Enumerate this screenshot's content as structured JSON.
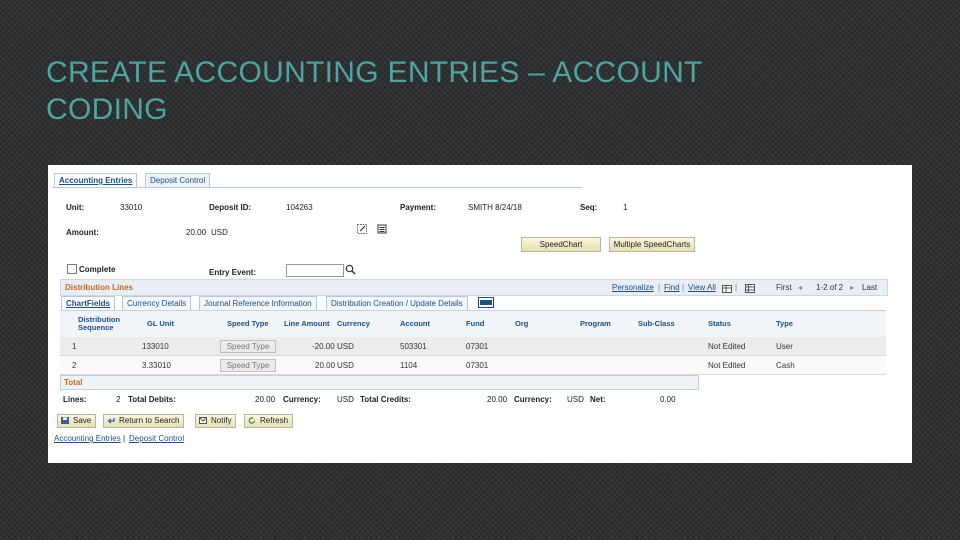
{
  "slide": {
    "title_line1": "CREATE ACCOUNTING ENTRIES – ACCOUNT",
    "title_line2": "CODING"
  },
  "tabs": [
    {
      "label": "Accounting Entries",
      "active": true
    },
    {
      "label": "Deposit Control",
      "active": false
    }
  ],
  "header": {
    "unit_label": "Unit:",
    "unit_value": "33010",
    "deposit_label": "Deposit ID:",
    "deposit_value": "104263",
    "payment_label": "Payment:",
    "payment_value": "SMITH 8/24/18",
    "seq_label": "Seq:",
    "seq_value": "1",
    "amount_label": "Amount:",
    "amount_value": "20.00",
    "amount_currency": "USD"
  },
  "buttons": {
    "speedchart": "SpeedChart",
    "multiple_speedcharts": "Multiple SpeedCharts"
  },
  "complete": {
    "label": "Complete",
    "checked": false
  },
  "entry_event": {
    "label": "Entry Event:",
    "value": ""
  },
  "distribution": {
    "title": "Distribution Lines",
    "nav": {
      "personalize": "Personalize",
      "find": "Find",
      "view_all": "View All",
      "first": "First",
      "count": "1-2 of 2",
      "last": "Last"
    },
    "subtabs": [
      "ChartFields",
      "Currency Details",
      "Journal Reference Information",
      "Distribution Creation / Update Details"
    ],
    "columns": {
      "seq1": "Distribution",
      "seq2": "Sequence",
      "gl_unit": "GL Unit",
      "speed_type": "Speed Type",
      "line_amount": "Line Amount",
      "currency": "Currency",
      "account": "Account",
      "fund": "Fund",
      "org": "Org",
      "program": "Program",
      "subclass": "Sub-Class",
      "status": "Status",
      "type": "Type"
    },
    "rows": [
      {
        "seq": "1",
        "gl_unit": "133010",
        "speed_type": "Speed Type",
        "line_amount": "-20.00",
        "currency": "USD",
        "account": "503301",
        "fund": "07301",
        "org": "",
        "program": "",
        "subclass": "",
        "status": "Not Edited",
        "type": "User"
      },
      {
        "seq": "2",
        "gl_unit": "3.33010",
        "speed_type": "Speed Type",
        "line_amount": "20.00",
        "currency": "USD",
        "account": "1104",
        "fund": "07301",
        "org": "",
        "program": "",
        "subclass": "",
        "status": "Not Edited",
        "type": "Cash"
      }
    ]
  },
  "totals": {
    "title": "Total",
    "lines_label": "Lines:",
    "lines_value": "2",
    "total_debits_label": "Total Debits:",
    "total_debits_value": "20.00",
    "currency_label": "Currency:",
    "currency_value": "USD",
    "total_credits_label": "Total Credits:",
    "total_credits_value": "20.00",
    "currency2_label": "Currency:",
    "currency2_value": "USD",
    "net_label": "Net:",
    "net_value": "0.00"
  },
  "toolbar": {
    "save": "Save",
    "return": "Return to Search",
    "notify": "Notify",
    "refresh": "Refresh"
  },
  "footer_links": {
    "accounting": "Accounting Entries",
    "sep": "|",
    "deposit": "Deposit Control"
  },
  "colors": {
    "title": "#4fa3a0",
    "section_title": "#c46a2b",
    "link": "#1c4f8a"
  }
}
